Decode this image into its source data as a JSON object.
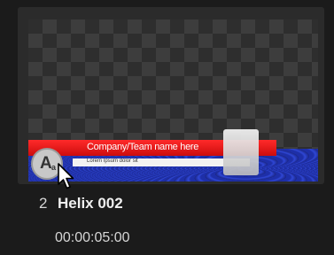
{
  "clip": {
    "index": "2",
    "title": "Helix 002",
    "duration": "00:00:05:00"
  },
  "preview": {
    "lower_third_title": "Company/Team name here",
    "lower_third_subtitle": "Lorem Ipsum dolor sit",
    "font_badge_letter": "A",
    "font_badge_sub": "a",
    "icons": [
      "font-badge-icon",
      "mouse-pointer-icon"
    ]
  },
  "colors": {
    "background": "#1b1b1b",
    "card": "#2b2b2b",
    "lower_third_red": "#e51818",
    "lower_third_blue": "#1e2fa8"
  }
}
